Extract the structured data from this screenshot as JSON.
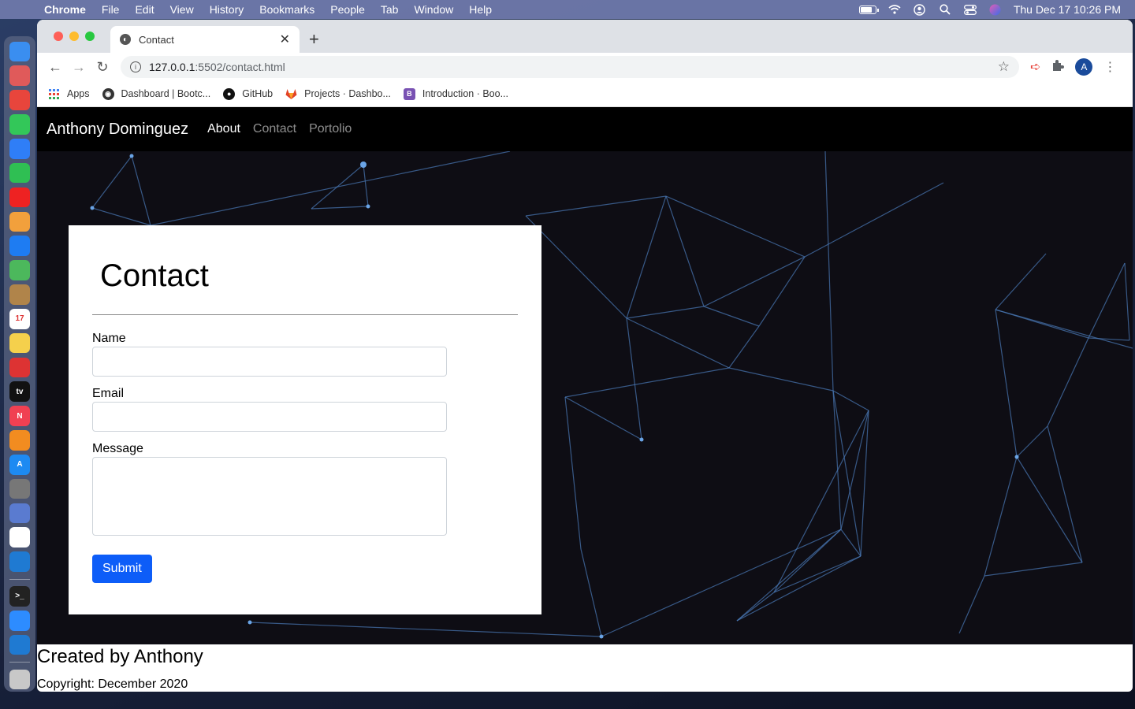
{
  "menubar": {
    "app": "Chrome",
    "items": [
      "File",
      "Edit",
      "View",
      "History",
      "Bookmarks",
      "People",
      "Tab",
      "Window",
      "Help"
    ],
    "datetime": "Thu Dec 17  10:26 PM"
  },
  "dock": {
    "apps": [
      {
        "name": "finder",
        "color": "#3a8ef0",
        "glyph": ""
      },
      {
        "name": "launchpad",
        "color": "#e05a5a",
        "glyph": ""
      },
      {
        "name": "chrome",
        "color": "#e8453c",
        "glyph": ""
      },
      {
        "name": "messages",
        "color": "#33c759",
        "glyph": ""
      },
      {
        "name": "mail",
        "color": "#2f7ef7",
        "glyph": ""
      },
      {
        "name": "facetime",
        "color": "#2fbf53",
        "glyph": ""
      },
      {
        "name": "youtube-music",
        "color": "#e22",
        "glyph": ""
      },
      {
        "name": "photos",
        "color": "#f2a03c",
        "glyph": ""
      },
      {
        "name": "safari",
        "color": "#1e7cf2",
        "glyph": ""
      },
      {
        "name": "maps",
        "color": "#4cb85c",
        "glyph": ""
      },
      {
        "name": "contacts",
        "color": "#b0844a",
        "glyph": ""
      },
      {
        "name": "calendar",
        "color": "#ffffff",
        "glyph": "17"
      },
      {
        "name": "notes",
        "color": "#f5d04c",
        "glyph": ""
      },
      {
        "name": "photo-booth",
        "color": "#d33",
        "glyph": ""
      },
      {
        "name": "apple-tv",
        "color": "#111111",
        "glyph": "tv"
      },
      {
        "name": "news",
        "color": "#f04052",
        "glyph": "N"
      },
      {
        "name": "books",
        "color": "#f28c20",
        "glyph": ""
      },
      {
        "name": "app-store",
        "color": "#1d8af2",
        "glyph": "A"
      },
      {
        "name": "system-preferences",
        "color": "#777",
        "glyph": ""
      },
      {
        "name": "preview",
        "color": "#5a7bd0",
        "glyph": ""
      },
      {
        "name": "slack",
        "color": "#ffffff",
        "glyph": ""
      },
      {
        "name": "vscode",
        "color": "#1f7ad2",
        "glyph": ""
      },
      {
        "name": "terminal",
        "color": "#222",
        "glyph": ">_"
      },
      {
        "name": "zoom",
        "color": "#2d8cff",
        "glyph": ""
      },
      {
        "name": "vscode-2",
        "color": "#1f7ad2",
        "glyph": ""
      },
      {
        "name": "trash",
        "color": "#c8c8c8",
        "glyph": ""
      }
    ]
  },
  "browser": {
    "tab_title": "Contact",
    "url_host": "127.0.0.1",
    "url_rest": ":5502/contact.html",
    "avatar_letter": "A",
    "bookmarks": [
      {
        "label": "Apps",
        "icon": "apps-icon",
        "color": "#4285f4"
      },
      {
        "label": "Dashboard | Bootc...",
        "icon": "bootcamp-icon",
        "color": "#333333"
      },
      {
        "label": "GitHub",
        "icon": "github-icon",
        "color": "#111111"
      },
      {
        "label": "Projects · Dashbo...",
        "icon": "gitlab-icon",
        "color": "#e24329"
      },
      {
        "label": "Introduction · Boo...",
        "icon": "bootstrap-icon",
        "color": "#7952b3"
      }
    ]
  },
  "site": {
    "brand": "Anthony Dominguez",
    "nav": [
      {
        "label": "About",
        "active": true
      },
      {
        "label": "Contact",
        "active": false
      },
      {
        "label": "Portolio",
        "active": false
      }
    ],
    "form": {
      "title": "Contact",
      "name_label": "Name",
      "email_label": "Email",
      "message_label": "Message",
      "name_value": "",
      "email_value": "",
      "message_value": "",
      "submit_label": "Submit"
    },
    "footer": {
      "title": "Created by Anthony",
      "copyright": "Copyright: December 2020"
    }
  },
  "colors": {
    "accent": "#0d5df8",
    "navbar_bg": "#000000",
    "hero_bg": "#0e0d14",
    "network_line": "#4a7ab8"
  }
}
